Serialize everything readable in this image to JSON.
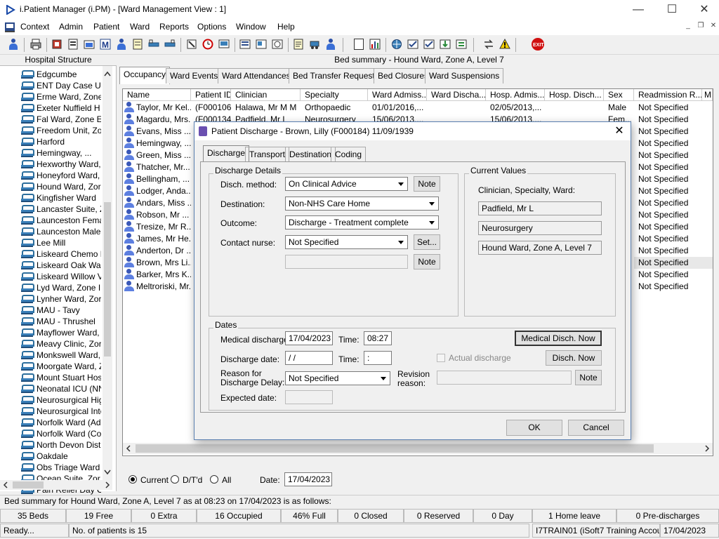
{
  "window": {
    "title": "i.Patient Manager (i.PM) - [Ward Management View : 1]",
    "minimize": "—",
    "maximize": "☐",
    "close": "✕"
  },
  "menu": [
    "Context",
    "Admin",
    "Patient",
    "Ward",
    "Reports",
    "Options",
    "Window",
    "Help"
  ],
  "mdi_controls": [
    "_",
    "❐",
    "✕"
  ],
  "toolbar_exit_label": "EXIT",
  "left_panel": {
    "header": "Hospital Structure",
    "wards": [
      "Edgcumbe",
      "ENT Day Case U",
      "Erme Ward, Zone",
      "Exeter Nuffield H",
      "Fal Ward, Zone E",
      "Freedom Unit, Zo",
      "Harford",
      "Hemingway, ...",
      "Hexworthy Ward,",
      "Honeyford Ward,",
      "Hound Ward, Zor",
      "Kingfisher Ward",
      "Lancaster Suite, Z",
      "Launceston Fema",
      "Launceston Male",
      "Lee Mill",
      "Liskeard Chemo D",
      "Liskeard Oak Wa",
      "Liskeard Willow V",
      "Lyd Ward, Zone I",
      "Lynher Ward, Zor",
      "MAU - Tavy",
      "MAU - Thrushel",
      "Mayflower Ward,",
      "Meavy Clinic, Zor",
      "Monkswell Ward,",
      "Moorgate Ward, Z",
      "Mount Stuart Hos",
      "Neonatal ICU (NN",
      "Neurosurgical Hig",
      "Neurosurgical Inte",
      "Norfolk Ward (Ad",
      "Norfolk Ward (Co",
      "North Devon Dist",
      "Oakdale",
      "Obs Triage Ward",
      "Ocean Suite, Zor",
      "Pain Relief Day C"
    ]
  },
  "main": {
    "header": "Bed summary - Hound Ward, Zone A, Level 7",
    "tabs": [
      "Occupancy",
      "Ward Events",
      "Ward Attendances",
      "Bed Transfer Requests",
      "Bed Closures",
      "Ward Suspensions"
    ],
    "columns": [
      "Name",
      "Patient ID",
      "Clinician",
      "Specialty",
      "Ward Admiss...",
      "Ward Discha...",
      "Hosp. Admis...",
      "Hosp. Disch...",
      "Sex",
      "Readmission R...",
      "M"
    ],
    "rows": [
      {
        "name": "Taylor, Mr Kel...",
        "id": "(F000106)",
        "clinician": "Halawa, Mr M M",
        "specialty": "Orthopaedic",
        "ward_adm": "01/01/2016,...",
        "hosp_adm": "02/05/2013,...",
        "sex": "Male",
        "readm": "Not Specified"
      },
      {
        "name": "Magardu, Mrs...",
        "id": "(F000134)",
        "clinician": "Padfield, Mr L",
        "specialty": "Neurosurgery",
        "ward_adm": "15/06/2013,...",
        "hosp_adm": "15/06/2013,...",
        "sex": "Fem...",
        "readm": "Not Specified"
      },
      {
        "name": "Evans, Miss ...",
        "readm": "Not Specified"
      },
      {
        "name": "Hemingway, ...",
        "readm": "Not Specified"
      },
      {
        "name": "Green, Miss ...",
        "readm": "Not Specified"
      },
      {
        "name": "Thatcher, Mr...",
        "readm": "Not Specified"
      },
      {
        "name": "Bellingham, ...",
        "readm": "Not Specified"
      },
      {
        "name": "Lodger, Anda...",
        "readm": "Not Specified"
      },
      {
        "name": "Andars, Miss ...",
        "readm": "Not Specified"
      },
      {
        "name": "Robson, Mr ...",
        "readm": "Not Specified"
      },
      {
        "name": "Tresize, Mr R...",
        "readm": "Not Specified"
      },
      {
        "name": "James, Mr He...",
        "readm": "Not Specified"
      },
      {
        "name": "Anderton, Dr ...",
        "readm": "Not Specified"
      },
      {
        "name": "Brown, Mrs Li...",
        "readm": "Not Specified"
      },
      {
        "name": "Barker, Mrs K...",
        "readm": "Not Specified"
      },
      {
        "name": "Meltroriski, Mr...",
        "readm": "Not Specified"
      }
    ],
    "filter": {
      "current": "Current",
      "dtd": "D/T'd",
      "all": "All",
      "date_label": "Date:",
      "date_value": "17/04/2023"
    }
  },
  "dialog": {
    "title": "Patient Discharge - Brown, Lilly (F000184) 11/09/1939",
    "tabs": [
      "Discharge",
      "Transport",
      "Destination",
      "Coding"
    ],
    "discharge_details": {
      "label": "Discharge Details",
      "method_label": "Disch. method:",
      "method_value": "On Clinical Advice",
      "destination_label": "Destination:",
      "destination_value": "Non-NHS Care Home",
      "outcome_label": "Outcome:",
      "outcome_value": "Discharge - Treatment complete",
      "nurse_label": "Contact nurse:",
      "nurse_value": "Not Specified",
      "note_label": "Note",
      "set_label": "Set...",
      "note2_label": "Note"
    },
    "current_values": {
      "label": "Current Values",
      "heading": "Clinician, Specialty, Ward:",
      "clinician": "Padfield, Mr L",
      "specialty": "Neurosurgery",
      "ward": "Hound Ward, Zone A, Level 7"
    },
    "dates": {
      "label": "Dates",
      "medical_label": "Medical discharge:",
      "medical_value": "17/04/2023",
      "time_label": "Time:",
      "medical_time": "08:27",
      "medical_now": "Medical Disch. Now",
      "discharge_label": "Discharge date:",
      "discharge_value": " /  /",
      "time2_label": "Time:",
      "discharge_time": " :",
      "actual_label": "Actual discharge",
      "disch_now": "Disch. Now",
      "reason_label_1": "Reason for",
      "reason_label_2": "Discharge Delay:",
      "reason_value": "Not Specified",
      "revision_label_1": "Revision",
      "revision_label_2": "reason:",
      "revision_note": "Note",
      "expected_label": "Expected date:"
    },
    "ok": "OK",
    "cancel": "Cancel"
  },
  "status": {
    "summary_line": "Bed summary for Hound Ward, Zone A, Level 7 as at 08:23 on 17/04/2023 is as follows:",
    "cells": [
      "35 Beds",
      "19 Free",
      "0 Extra",
      "16 Occupied",
      "46% Full",
      "0 Closed",
      "0 Reserved",
      "0 Day",
      "1 Home leave",
      "0 Pre-discharges"
    ],
    "ready": "Ready...",
    "patients": "No. of patients is 15",
    "account": "I7TRAIN01 (iSoft7 Training Account)",
    "date": "17/04/2023"
  },
  "colors": {
    "accent": "#0078d7",
    "exit_red": "#d01010"
  }
}
